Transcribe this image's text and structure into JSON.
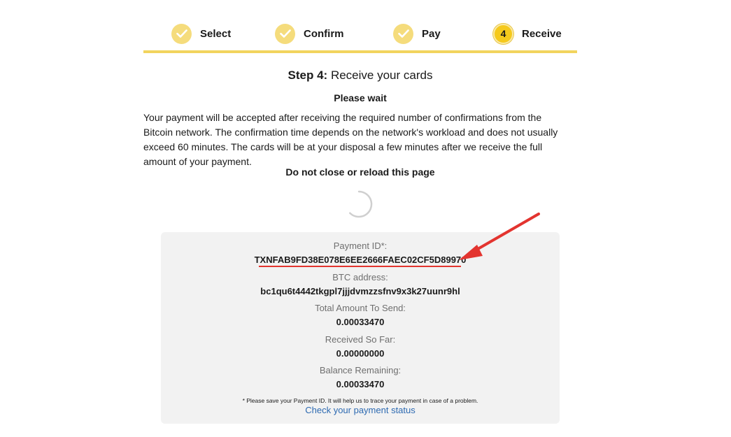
{
  "stepper": {
    "steps": [
      {
        "label": "Select",
        "state": "completed"
      },
      {
        "label": "Confirm",
        "state": "completed"
      },
      {
        "label": "Pay",
        "state": "completed"
      },
      {
        "label": "Receive",
        "state": "active",
        "number": "4"
      }
    ],
    "accent_color": "#f2d45e"
  },
  "heading": {
    "prefix": "Step 4:",
    "text": " Receive your cards"
  },
  "subtitle": "Please wait",
  "description": "Your payment will be accepted after receiving the required number of confirmations from the Bitcoin network. The confirmation time depends on the network's workload and does not usually exceed 60 minutes. The cards will be at your disposal a few minutes after we receive the full amount of your payment.",
  "warning": "Do not close or reload this page",
  "payment": {
    "payment_id_label": "Payment ID*:",
    "payment_id": "TXNFAB9FD38E078E6EE2666FAEC02CF5D89970",
    "btc_address_label": "BTC address:",
    "btc_address": "bc1qu6t4442tkgpl7jjjdvmzzsfnv9x3k27uunr9hl",
    "total_label": "Total Amount To Send:",
    "total": "0.00033470",
    "received_label": "Received So Far:",
    "received": "0.00000000",
    "balance_label": "Balance Remaining:",
    "balance": "0.00033470",
    "note": "* Please save your Payment ID. It will help us to trace your payment in case of a problem.",
    "status_link": "Check your payment status"
  },
  "icons": {
    "completed_step": "checkmark-icon",
    "loading": "spinner-icon",
    "annotation": "red-arrow-icon"
  },
  "colors": {
    "highlight": "#e3342f",
    "link": "#2d6ab1"
  }
}
